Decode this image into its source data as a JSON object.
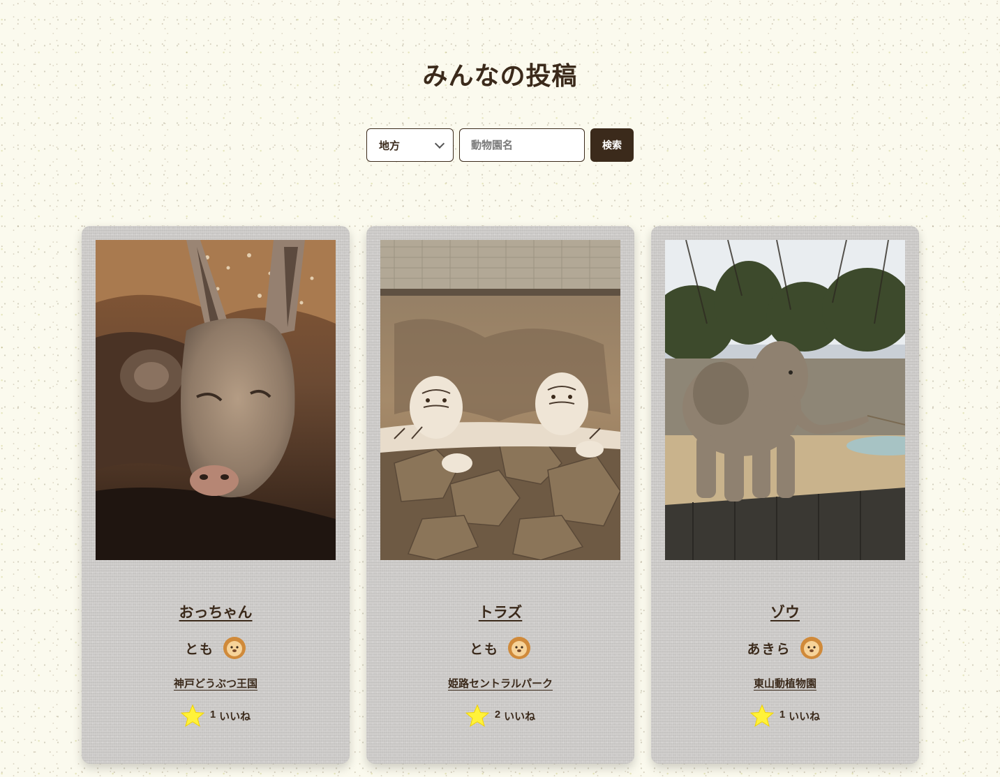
{
  "page": {
    "title": "みんなの投稿"
  },
  "search": {
    "region_label": "地方",
    "zoo_placeholder": "動物園名",
    "search_label": "検索"
  },
  "icons": {
    "dropdown": "chevron-down-icon",
    "avatar": "lion-icon",
    "like": "star-icon"
  },
  "colors": {
    "primary": "#3b2a1b",
    "background": "#fbfaee",
    "card": "#cdcbc9",
    "star": "#fff23a"
  },
  "posts": [
    {
      "animal_name": "おっちゃん",
      "user_name": "とも",
      "zoo_name": "神戸どうぶつ王国",
      "like_count": "1",
      "like_label": "いいね",
      "photo_subject": "kangaroo"
    },
    {
      "animal_name": "トラズ",
      "user_name": "とも",
      "zoo_name": "姫路セントラルパーク",
      "like_count": "2",
      "like_label": "いいね",
      "photo_subject": "white tigers"
    },
    {
      "animal_name": "ゾウ",
      "user_name": "あきら",
      "zoo_name": "東山動植物園",
      "like_count": "1",
      "like_label": "いいね",
      "photo_subject": "elephant"
    }
  ]
}
